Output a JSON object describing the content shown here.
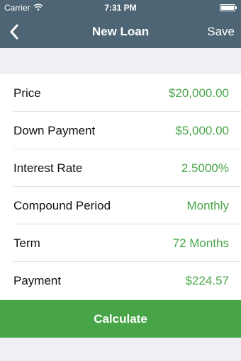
{
  "status_bar": {
    "carrier": "Carrier",
    "time": "7:31 PM"
  },
  "nav": {
    "title": "New Loan",
    "save_label": "Save",
    "back_icon": "chevron-left-icon"
  },
  "rows": [
    {
      "label": "Price",
      "value": "$20,000.00"
    },
    {
      "label": "Down Payment",
      "value": "$5,000.00"
    },
    {
      "label": "Interest Rate",
      "value": "2.5000%"
    },
    {
      "label": "Compound Period",
      "value": "Monthly"
    },
    {
      "label": "Term",
      "value": "72 Months"
    },
    {
      "label": "Payment",
      "value": "$224.57"
    }
  ],
  "calculate_label": "Calculate",
  "colors": {
    "nav": "#4d6574",
    "accent": "#4aa64b",
    "button": "#47a547"
  }
}
